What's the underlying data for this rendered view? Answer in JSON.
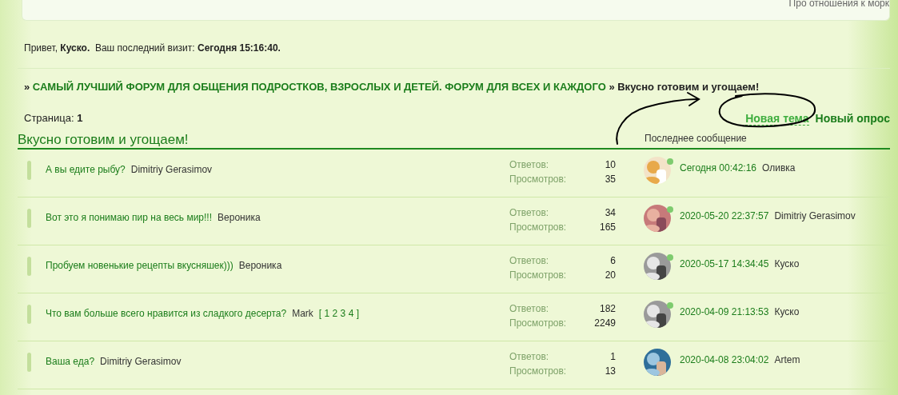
{
  "top_card": {
    "text": "Про отношения к морк"
  },
  "greeting": {
    "hello": "Привет,",
    "user": "Куско.",
    "last_visit_label": "Ваш последний визит:",
    "last_visit": "Сегодня 15:16:40."
  },
  "breadcrumb": [
    {
      "sep": "»",
      "label": "САМЫЙ ЛУЧШИЙ ФОРУМ ДЛЯ ОБЩЕНИЯ ПОДРОСТКОВ, ВЗРОСЛЫХ И ДЕТЕЙ. ФОРУМ ДЛЯ ВСЕХ И КАЖДОГО",
      "current": false
    },
    {
      "sep": "»",
      "label": "Вкусно готовим и угощаем!",
      "current": true
    }
  ],
  "pager": {
    "label": "Страница:",
    "page": "1"
  },
  "actions": [
    {
      "label": "Новая тема",
      "kind": "dashed"
    },
    {
      "label": "Новый опрос",
      "kind": "plain"
    }
  ],
  "forum": {
    "title": "Вкусно готовим и угощаем!",
    "last_post_heading": "Последнее сообщение"
  },
  "topics": [
    {
      "title": "А вы едите рыбу?",
      "author": "Dimitriy Gerasimov",
      "replies_label": "Ответов:",
      "replies": "10",
      "views_label": "Просмотров:",
      "views": "35",
      "last_time": "Сегодня 00:42:16",
      "last_user": "Оливка",
      "online": true
    },
    {
      "title": "Вот это я понимаю пир на весь мир!!!",
      "author": "Вероника",
      "replies_label": "Ответов:",
      "replies": "34",
      "views_label": "Просмотров:",
      "views": "165",
      "last_time": "2020-05-20 22:37:57",
      "last_user": "Dimitriy Gerasimov",
      "online": true
    },
    {
      "title": "Пробуем новенькие рецепты вкусняшек)))",
      "author": "Вероника",
      "replies_label": "Ответов:",
      "replies": "6",
      "views_label": "Просмотров:",
      "views": "20",
      "last_time": "2020-05-17 14:34:45",
      "last_user": "Куско",
      "online": true
    },
    {
      "title": "Что вам больше всего нравится из сладкого десерта?",
      "author": "Mark",
      "pages_open": "[",
      "pages": [
        "1",
        "2",
        "3",
        "4"
      ],
      "pages_close": "]",
      "replies_label": "Ответов:",
      "replies": "182",
      "views_label": "Просмотров:",
      "views": "2249",
      "last_time": "2020-04-09 21:13:53",
      "last_user": "Куско",
      "online": true
    },
    {
      "title": "Ваша еда?",
      "author": "Dimitriy Gerasimov",
      "replies_label": "Ответов:",
      "replies": "1",
      "views_label": "Просмотров:",
      "views": "13",
      "last_time": "2020-04-08 23:04:02",
      "last_user": "Artem",
      "online": false
    }
  ]
}
